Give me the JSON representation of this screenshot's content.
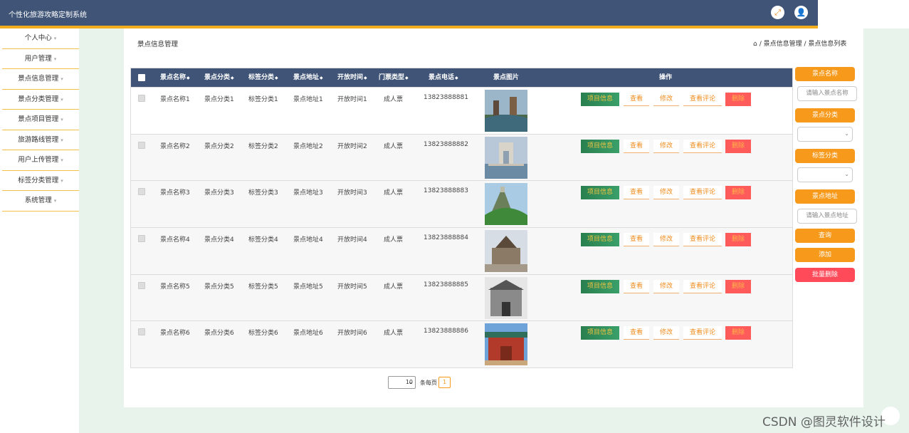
{
  "app": {
    "title": "个性化旅游攻略定制系统"
  },
  "topbar": {
    "fullscreen_icon": "expand-icon",
    "user_icon": "user-icon",
    "accent": "#3f5476",
    "underline": "#f2ad1e"
  },
  "sidebar": {
    "items": [
      {
        "label": "个人中心"
      },
      {
        "label": "用户管理"
      },
      {
        "label": "景点信息管理"
      },
      {
        "label": "景点分类管理"
      },
      {
        "label": "景点项目管理"
      },
      {
        "label": "旅游路线管理"
      },
      {
        "label": "用户上传管理"
      },
      {
        "label": "标签分类管理"
      },
      {
        "label": "系统管理"
      }
    ]
  },
  "main": {
    "title": "景点信息管理",
    "breadcrumb": "/ 景点信息管理 / 景点信息列表"
  },
  "table": {
    "headers": {
      "name": "景点名称",
      "category": "景点分类",
      "tag": "标签分类",
      "address": "景点地址",
      "open_time": "开放时间",
      "ticket": "门票类型",
      "phone": "景点电话",
      "image": "景点图片",
      "actions": "操作"
    },
    "rows": [
      {
        "name": "景点名称1",
        "category": "景点分类1",
        "tag": "标签分类1",
        "address": "景点地址1",
        "open_time": "开放时间1",
        "ticket": "成人票",
        "phone": "13823888881"
      },
      {
        "name": "景点名称2",
        "category": "景点分类2",
        "tag": "标签分类2",
        "address": "景点地址2",
        "open_time": "开放时间2",
        "ticket": "成人票",
        "phone": "13823888882"
      },
      {
        "name": "景点名称3",
        "category": "景点分类3",
        "tag": "标签分类3",
        "address": "景点地址3",
        "open_time": "开放时间3",
        "ticket": "成人票",
        "phone": "13823888883"
      },
      {
        "name": "景点名称4",
        "category": "景点分类4",
        "tag": "标签分类4",
        "address": "景点地址4",
        "open_time": "开放时间4",
        "ticket": "成人票",
        "phone": "13823888884"
      },
      {
        "name": "景点名称5",
        "category": "景点分类5",
        "tag": "标签分类5",
        "address": "景点地址5",
        "open_time": "开放时间5",
        "ticket": "成人票",
        "phone": "13823888885"
      },
      {
        "name": "景点名称6",
        "category": "景点分类6",
        "tag": "标签分类6",
        "address": "景点地址6",
        "open_time": "开放时间6",
        "ticket": "成人票",
        "phone": "13823888886"
      }
    ],
    "actions": {
      "project": "项目信息",
      "view": "查看",
      "edit": "修改",
      "comments": "查看评论",
      "delete": "删除"
    }
  },
  "search_panel": {
    "name_label": "景点名称",
    "name_placeholder": "请输入景点名称",
    "category_label": "景点分类",
    "tag_label": "标签分类",
    "address_label": "景点地址",
    "address_placeholder": "请输入景点地址",
    "query_button": "查询",
    "add_button": "添加",
    "batch_delete_button": "批量删除"
  },
  "pagination": {
    "page_size": "10",
    "per_page_label": "条每页",
    "current_page": "1"
  },
  "watermark": "CSDN @图灵软件设计"
}
